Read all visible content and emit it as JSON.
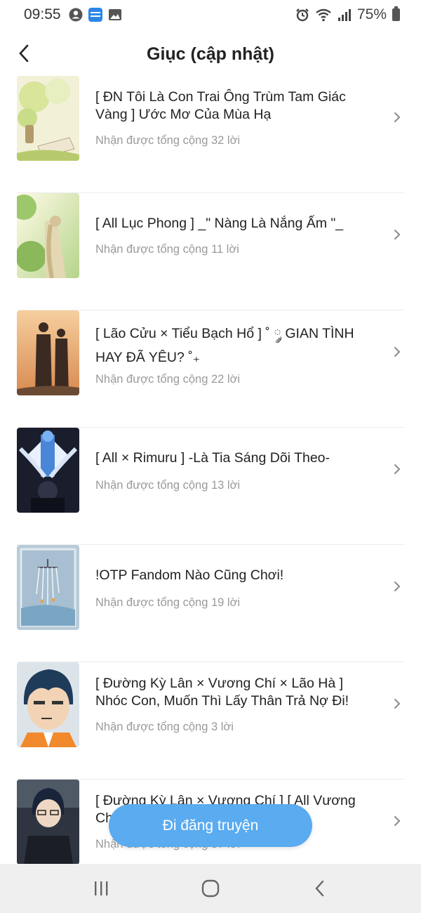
{
  "status_bar": {
    "time": "09:55",
    "battery": "75%"
  },
  "header": {
    "title": "Giục (cập nhật)"
  },
  "items": [
    {
      "title": "[ ĐN Tôi Là Con Trai Ông Trùm Tam Giác Vàng ] Ước Mơ Của Mùa Hạ",
      "subtitle": "Nhận được tổng cộng 32 lời"
    },
    {
      "title": "[ All Lục Phong ] _\" Nàng Là Nắng Ấm \"_",
      "subtitle": "Nhận được tổng cộng 11 lời"
    },
    {
      "title": "[ Lão Cửu × Tiểu Bạch Hổ ] ˚ ༘ GIAN TÌNH HAY ĐÃ YÊU? ˚₊",
      "subtitle": "Nhận được tổng cộng 22 lời"
    },
    {
      "title": "[ All × Rimuru ] -Là Tia Sáng Dõi Theo-",
      "subtitle": "Nhận được tổng cộng 13 lời"
    },
    {
      "title": "!OTP Fandom Nào Cũng Chơi!",
      "subtitle": "Nhận được tổng cộng 19 lời"
    },
    {
      "title": "[ Đường Kỳ Lân × Vương Chí × Lão Hà ] Nhóc Con, Muốn Thì Lấy Thân Trả Nợ Đi!",
      "subtitle": "Nhận được tổng cộng 3 lời"
    },
    {
      "title": "[ Đường Kỳ Lân × Vương Chí ] [ All Vương Chí ]",
      "subtitle": "Nhận được tổng cộng 37 lời"
    }
  ],
  "post_button": {
    "label": "Đi đăng truyện"
  },
  "colors": {
    "accent": "#5aabf0",
    "subtitle": "#9a9a9a",
    "nav_bg": "#efefef"
  }
}
